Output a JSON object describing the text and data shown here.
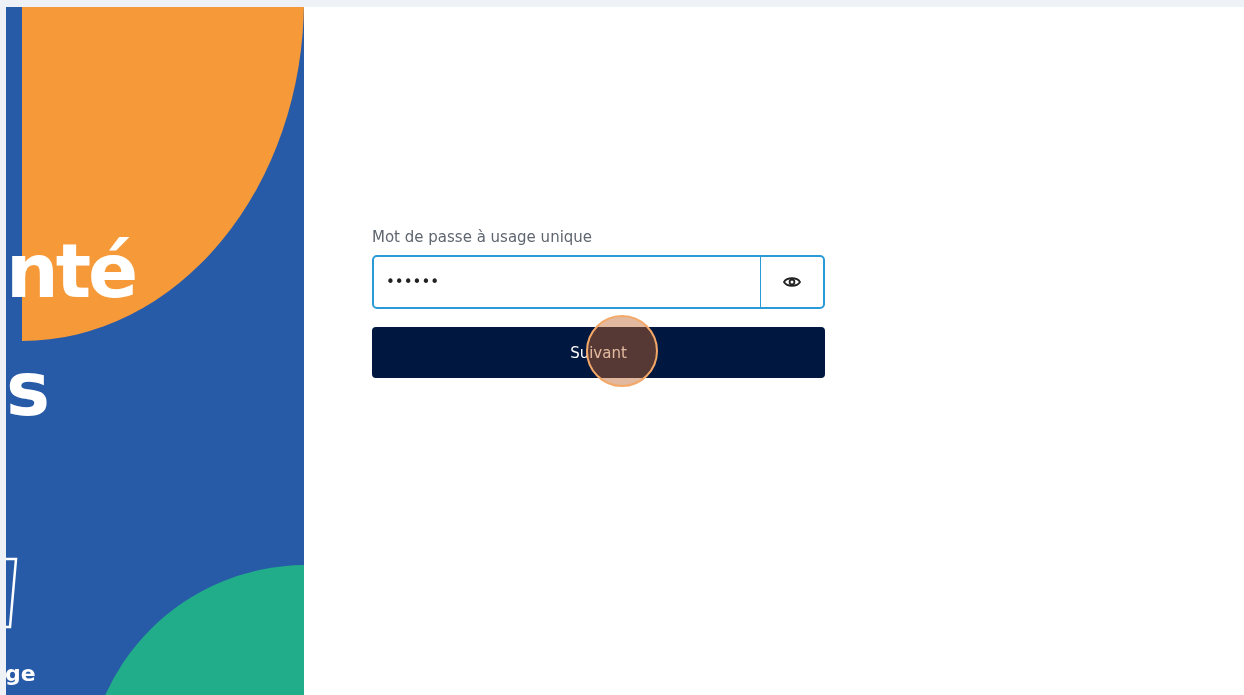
{
  "side_panel": {
    "headline_fragments": [
      "nté",
      "s"
    ],
    "caption_fragment": "ge"
  },
  "form": {
    "label": "Mot de passe à usage unique",
    "password": {
      "value": "••••••",
      "focused": true
    },
    "submit": {
      "label": "Suivant"
    }
  },
  "click_indicator": {
    "on": true
  }
}
